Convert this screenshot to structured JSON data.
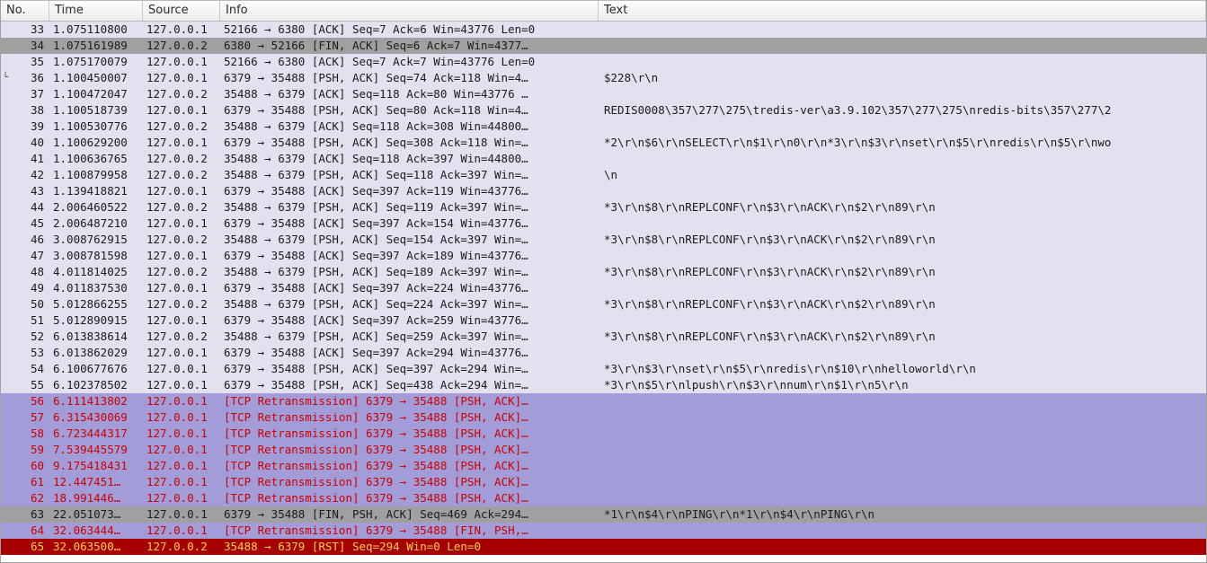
{
  "columns": {
    "no": "No.",
    "time": "Time",
    "source": "Source",
    "info": "Info",
    "text": "Text"
  },
  "packets": [
    {
      "no": "33",
      "time": "1.075110800",
      "src": "127.0.0.1",
      "info": "52166 → 6380 [ACK] Seq=7 Ack=6 Win=43776 Len=0",
      "text": "",
      "style": "norm"
    },
    {
      "no": "34",
      "time": "1.075161989",
      "src": "127.0.0.2",
      "info": "6380 → 52166 [FIN, ACK] Seq=6 Ack=7 Win=4377…",
      "text": "",
      "style": "grey"
    },
    {
      "no": "35",
      "time": "1.075170079",
      "src": "127.0.0.1",
      "info": "52166 → 6380 [ACK] Seq=7 Ack=7 Win=43776 Len=0",
      "text": "",
      "style": "norm"
    },
    {
      "no": "36",
      "time": "1.100450007",
      "src": "127.0.0.1",
      "info": "6379 → 35488 [PSH, ACK] Seq=74 Ack=118 Win=4…",
      "text": "$228\\r\\n",
      "style": "norm"
    },
    {
      "no": "37",
      "time": "1.100472047",
      "src": "127.0.0.2",
      "info": "35488 → 6379 [ACK] Seq=118 Ack=80 Win=43776 …",
      "text": "",
      "style": "norm"
    },
    {
      "no": "38",
      "time": "1.100518739",
      "src": "127.0.0.1",
      "info": "6379 → 35488 [PSH, ACK] Seq=80 Ack=118 Win=4…",
      "text": "REDIS0008\\357\\277\\275\\tredis-ver\\a3.9.102\\357\\277\\275\\nredis-bits\\357\\277\\2",
      "style": "norm"
    },
    {
      "no": "39",
      "time": "1.100530776",
      "src": "127.0.0.2",
      "info": "35488 → 6379 [ACK] Seq=118 Ack=308 Win=44800…",
      "text": "",
      "style": "norm"
    },
    {
      "no": "40",
      "time": "1.100629200",
      "src": "127.0.0.1",
      "info": "6379 → 35488 [PSH, ACK] Seq=308 Ack=118 Win=…",
      "text": "*2\\r\\n$6\\r\\nSELECT\\r\\n$1\\r\\n0\\r\\n*3\\r\\n$3\\r\\nset\\r\\n$5\\r\\nredis\\r\\n$5\\r\\nwo",
      "style": "norm"
    },
    {
      "no": "41",
      "time": "1.100636765",
      "src": "127.0.0.2",
      "info": "35488 → 6379 [ACK] Seq=118 Ack=397 Win=44800…",
      "text": "",
      "style": "norm"
    },
    {
      "no": "42",
      "time": "1.100879958",
      "src": "127.0.0.2",
      "info": "35488 → 6379 [PSH, ACK] Seq=118 Ack=397 Win=…",
      "text": "\\n",
      "style": "norm"
    },
    {
      "no": "43",
      "time": "1.139418821",
      "src": "127.0.0.1",
      "info": "6379 → 35488 [ACK] Seq=397 Ack=119 Win=43776…",
      "text": "",
      "style": "norm"
    },
    {
      "no": "44",
      "time": "2.006460522",
      "src": "127.0.0.2",
      "info": "35488 → 6379 [PSH, ACK] Seq=119 Ack=397 Win=…",
      "text": "*3\\r\\n$8\\r\\nREPLCONF\\r\\n$3\\r\\nACK\\r\\n$2\\r\\n89\\r\\n",
      "style": "norm"
    },
    {
      "no": "45",
      "time": "2.006487210",
      "src": "127.0.0.1",
      "info": "6379 → 35488 [ACK] Seq=397 Ack=154 Win=43776…",
      "text": "",
      "style": "norm"
    },
    {
      "no": "46",
      "time": "3.008762915",
      "src": "127.0.0.2",
      "info": "35488 → 6379 [PSH, ACK] Seq=154 Ack=397 Win=…",
      "text": "*3\\r\\n$8\\r\\nREPLCONF\\r\\n$3\\r\\nACK\\r\\n$2\\r\\n89\\r\\n",
      "style": "norm"
    },
    {
      "no": "47",
      "time": "3.008781598",
      "src": "127.0.0.1",
      "info": "6379 → 35488 [ACK] Seq=397 Ack=189 Win=43776…",
      "text": "",
      "style": "norm"
    },
    {
      "no": "48",
      "time": "4.011814025",
      "src": "127.0.0.2",
      "info": "35488 → 6379 [PSH, ACK] Seq=189 Ack=397 Win=…",
      "text": "*3\\r\\n$8\\r\\nREPLCONF\\r\\n$3\\r\\nACK\\r\\n$2\\r\\n89\\r\\n",
      "style": "norm"
    },
    {
      "no": "49",
      "time": "4.011837530",
      "src": "127.0.0.1",
      "info": "6379 → 35488 [ACK] Seq=397 Ack=224 Win=43776…",
      "text": "",
      "style": "norm"
    },
    {
      "no": "50",
      "time": "5.012866255",
      "src": "127.0.0.2",
      "info": "35488 → 6379 [PSH, ACK] Seq=224 Ack=397 Win=…",
      "text": "*3\\r\\n$8\\r\\nREPLCONF\\r\\n$3\\r\\nACK\\r\\n$2\\r\\n89\\r\\n",
      "style": "norm"
    },
    {
      "no": "51",
      "time": "5.012890915",
      "src": "127.0.0.1",
      "info": "6379 → 35488 [ACK] Seq=397 Ack=259 Win=43776…",
      "text": "",
      "style": "norm"
    },
    {
      "no": "52",
      "time": "6.013838614",
      "src": "127.0.0.2",
      "info": "35488 → 6379 [PSH, ACK] Seq=259 Ack=397 Win=…",
      "text": "*3\\r\\n$8\\r\\nREPLCONF\\r\\n$3\\r\\nACK\\r\\n$2\\r\\n89\\r\\n",
      "style": "norm"
    },
    {
      "no": "53",
      "time": "6.013862029",
      "src": "127.0.0.1",
      "info": "6379 → 35488 [ACK] Seq=397 Ack=294 Win=43776…",
      "text": "",
      "style": "norm"
    },
    {
      "no": "54",
      "time": "6.100677676",
      "src": "127.0.0.1",
      "info": "6379 → 35488 [PSH, ACK] Seq=397 Ack=294 Win=…",
      "text": "*3\\r\\n$3\\r\\nset\\r\\n$5\\r\\nredis\\r\\n$10\\r\\nhelloworld\\r\\n",
      "style": "norm"
    },
    {
      "no": "55",
      "time": "6.102378502",
      "src": "127.0.0.1",
      "info": "6379 → 35488 [PSH, ACK] Seq=438 Ack=294 Win=…",
      "text": "*3\\r\\n$5\\r\\nlpush\\r\\n$3\\r\\nnum\\r\\n$1\\r\\n5\\r\\n",
      "style": "norm"
    },
    {
      "no": "56",
      "time": "6.111413802",
      "src": "127.0.0.1",
      "info": "[TCP Retransmission] 6379 → 35488 [PSH, ACK]…",
      "text": "",
      "style": "retx"
    },
    {
      "no": "57",
      "time": "6.315430069",
      "src": "127.0.0.1",
      "info": "[TCP Retransmission] 6379 → 35488 [PSH, ACK]…",
      "text": "",
      "style": "retx"
    },
    {
      "no": "58",
      "time": "6.723444317",
      "src": "127.0.0.1",
      "info": "[TCP Retransmission] 6379 → 35488 [PSH, ACK]…",
      "text": "",
      "style": "retx"
    },
    {
      "no": "59",
      "time": "7.539445579",
      "src": "127.0.0.1",
      "info": "[TCP Retransmission] 6379 → 35488 [PSH, ACK]…",
      "text": "",
      "style": "retx"
    },
    {
      "no": "60",
      "time": "9.175418431",
      "src": "127.0.0.1",
      "info": "[TCP Retransmission] 6379 → 35488 [PSH, ACK]…",
      "text": "",
      "style": "retx"
    },
    {
      "no": "61",
      "time": "12.447451…",
      "src": "127.0.0.1",
      "info": "[TCP Retransmission] 6379 → 35488 [PSH, ACK]…",
      "text": "",
      "style": "retx"
    },
    {
      "no": "62",
      "time": "18.991446…",
      "src": "127.0.0.1",
      "info": "[TCP Retransmission] 6379 → 35488 [PSH, ACK]…",
      "text": "",
      "style": "retx"
    },
    {
      "no": "63",
      "time": "22.051073…",
      "src": "127.0.0.1",
      "info": "6379 → 35488 [FIN, PSH, ACK] Seq=469 Ack=294…",
      "text": "*1\\r\\n$4\\r\\nPING\\r\\n*1\\r\\n$4\\r\\nPING\\r\\n",
      "style": "grey"
    },
    {
      "no": "64",
      "time": "32.063444…",
      "src": "127.0.0.1",
      "info": "[TCP Retransmission] 6379 → 35488 [FIN, PSH,…",
      "text": "",
      "style": "retx"
    },
    {
      "no": "65",
      "time": "32.063500…",
      "src": "127.0.0.2",
      "info": "35488 → 6379 [RST] Seq=294 Win=0 Len=0",
      "text": "",
      "style": "rst"
    }
  ]
}
